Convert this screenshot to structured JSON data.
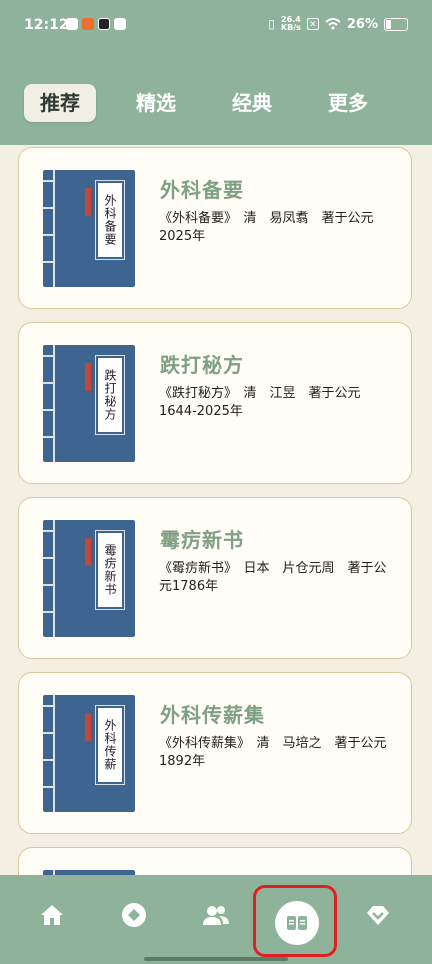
{
  "status_bar": {
    "time": "12:12",
    "net_speed_value": "26.4",
    "net_speed_unit": "KB/s",
    "battery": "26%"
  },
  "tabs": [
    {
      "label": "推荐",
      "active": true
    },
    {
      "label": "精选",
      "active": false
    },
    {
      "label": "经典",
      "active": false
    },
    {
      "label": "更多",
      "active": false
    }
  ],
  "books": [
    {
      "cover_title": "外科备要",
      "title": "外科备要",
      "description": "《外科备要》　清　易凤翥　著于公元2025年"
    },
    {
      "cover_title": "跌打秘方",
      "title": "跌打秘方",
      "description": "《跌打秘方》　清　江昱　著于公元1644-2025年"
    },
    {
      "cover_title": "霉疠新书",
      "title": "霉疠新书",
      "description": "《霉疠新书》　日本　片仓元周　著于公元1786年"
    },
    {
      "cover_title": "外科传薪",
      "title": "外科传薪集",
      "description": "《外科传薪集》　清　马培之　著于公元1892年"
    },
    {
      "cover_title": "",
      "title": "",
      "description": ""
    }
  ],
  "bottom_nav": [
    {
      "icon": "home-icon",
      "active": false
    },
    {
      "icon": "compass-icon",
      "active": false
    },
    {
      "icon": "people-icon",
      "active": false
    },
    {
      "icon": "book-icon",
      "active": true
    },
    {
      "icon": "heart-down-icon",
      "active": false
    }
  ],
  "colors": {
    "header_bg": "#8fb39a",
    "title_green": "#7fa083",
    "cover_blue": "#3e6590",
    "highlight_red": "#e0201e"
  }
}
